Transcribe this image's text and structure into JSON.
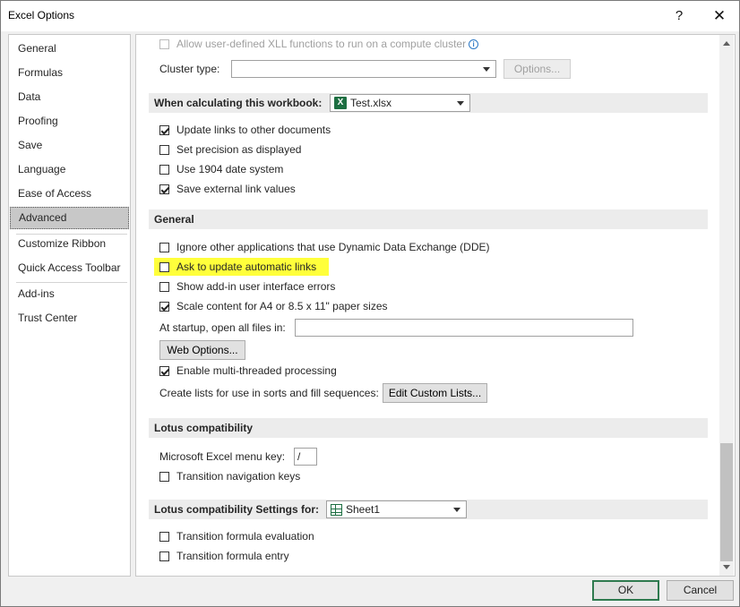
{
  "window": {
    "title": "Excel Options",
    "help_label": "?",
    "close_label": "✕"
  },
  "nav": {
    "items": [
      {
        "label": "General"
      },
      {
        "label": "Formulas"
      },
      {
        "label": "Data"
      },
      {
        "label": "Proofing"
      },
      {
        "label": "Save"
      },
      {
        "label": "Language"
      },
      {
        "label": "Ease of Access"
      },
      {
        "label": "Advanced",
        "selected": true
      },
      {
        "label": "Customize Ribbon"
      },
      {
        "label": "Quick Access Toolbar"
      },
      {
        "label": "Add-ins"
      },
      {
        "label": "Trust Center"
      }
    ]
  },
  "top": {
    "xll_label": "Allow user-defined XLL functions to run on a compute cluster",
    "cluster_type_label": "Cluster type:",
    "cluster_type_value": "",
    "options_button": "Options..."
  },
  "calc_workbook": {
    "header": "When calculating this workbook:",
    "workbook_value": "Test.xlsx",
    "excel_icon_letter": "X",
    "options": [
      {
        "label": "Update links to other documents",
        "checked": true
      },
      {
        "label": "Set precision as displayed",
        "checked": false
      },
      {
        "label": "Use 1904 date system",
        "checked": false
      },
      {
        "label": "Save external link values",
        "checked": true
      }
    ]
  },
  "general": {
    "header": "General",
    "dde_label": "Ignore other applications that use Dynamic Data Exchange (DDE)",
    "ask_update_label": "Ask to update automatic links",
    "addin_errors_label": "Show add-in user interface errors",
    "scale_content_label": "Scale content for A4 or 8.5 x 11\" paper sizes",
    "startup_label": "At startup, open all files in:",
    "startup_value": "",
    "web_options_button": "Web Options...",
    "multithread_label": "Enable multi-threaded processing",
    "custom_lists_label": "Create lists for use in sorts and fill sequences:",
    "edit_custom_lists_button": "Edit Custom Lists...",
    "highlight_color": "#ffff3b"
  },
  "lotus": {
    "header": "Lotus compatibility",
    "menu_key_label": "Microsoft Excel menu key:",
    "menu_key_value": "/",
    "transition_nav_label": "Transition navigation keys"
  },
  "lotus_settings": {
    "header": "Lotus compatibility Settings for:",
    "sheet_value": "Sheet1",
    "formula_eval_label": "Transition formula evaluation",
    "formula_entry_label": "Transition formula entry"
  },
  "footer": {
    "ok": "OK",
    "cancel": "Cancel"
  },
  "colors": {
    "ok_border": "#2f7a4f",
    "excel_green": "#1d6f42"
  }
}
